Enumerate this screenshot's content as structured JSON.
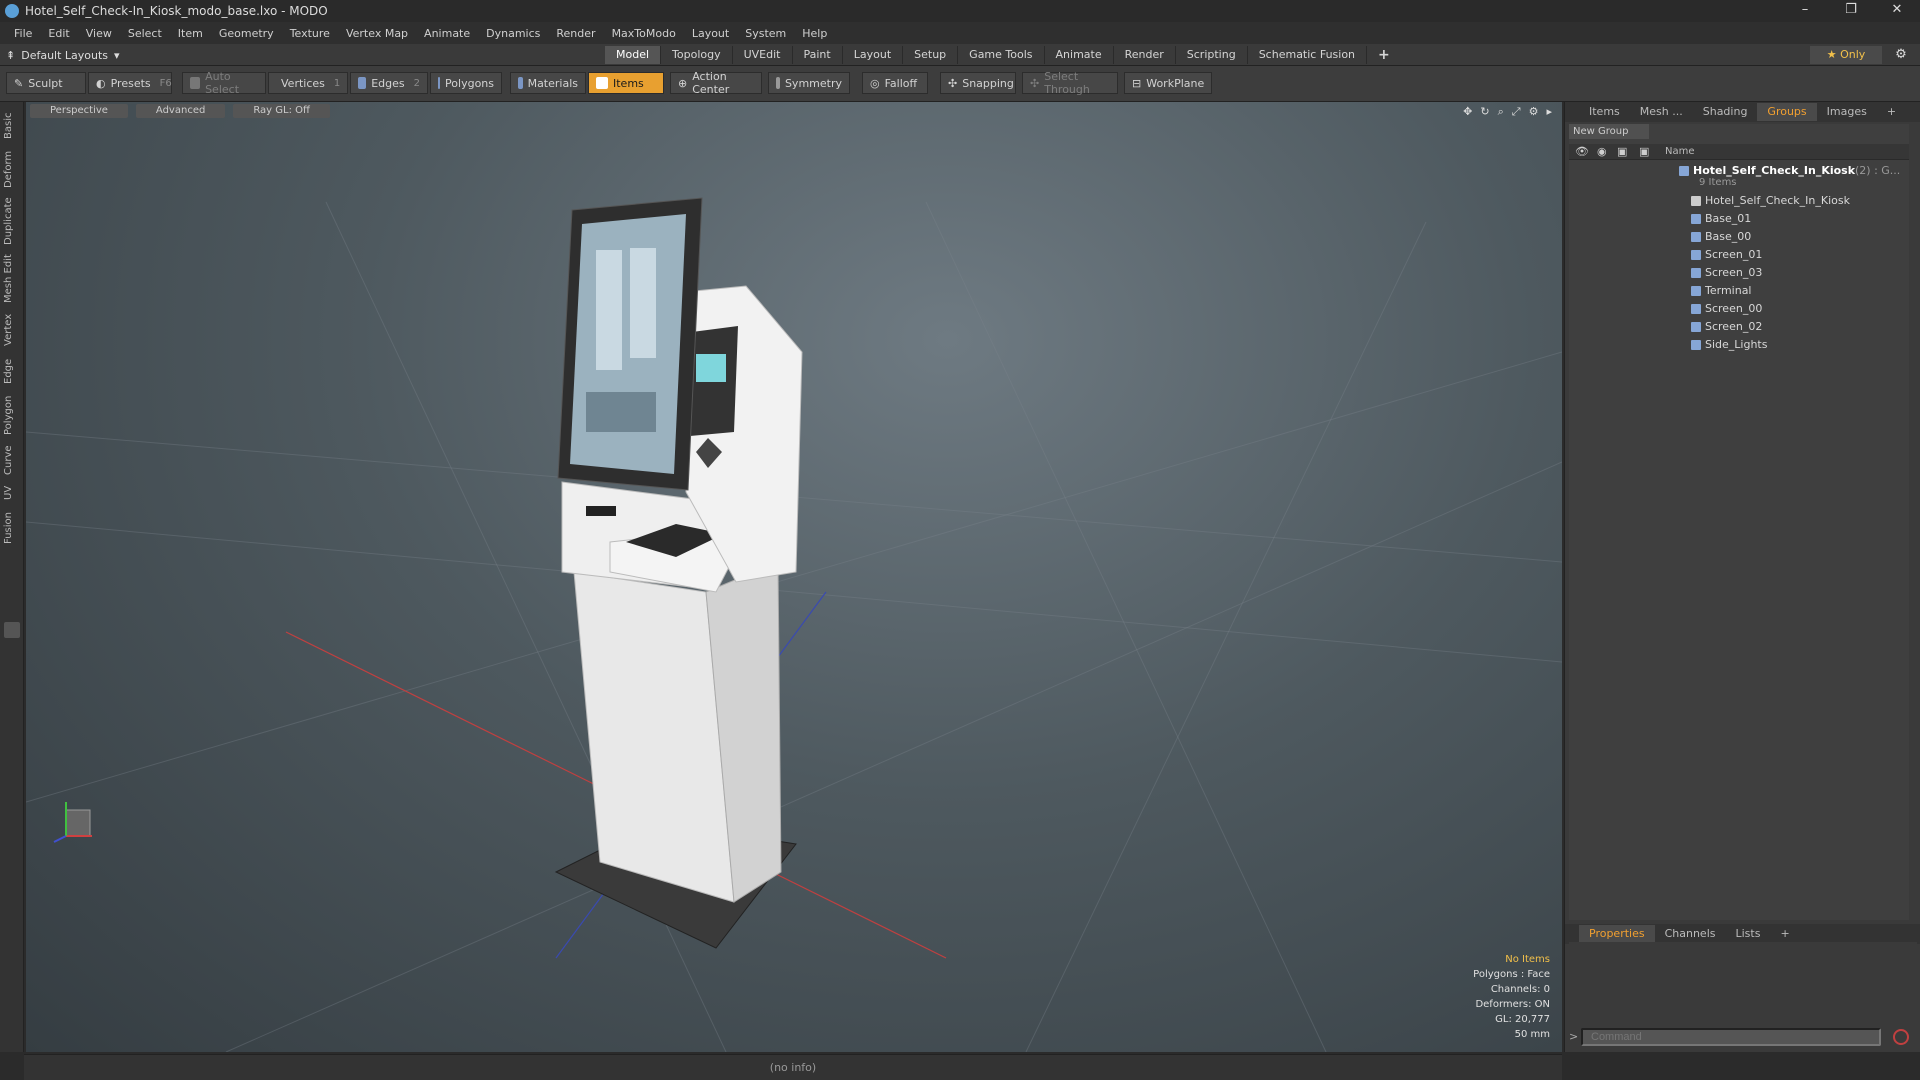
{
  "window": {
    "title": "Hotel_Self_Check-In_Kiosk_modo_base.lxo - MODO",
    "minimize": "–",
    "maximize": "❐",
    "close": "✕"
  },
  "menu": [
    "File",
    "Edit",
    "View",
    "Select",
    "Item",
    "Geometry",
    "Texture",
    "Vertex Map",
    "Animate",
    "Dynamics",
    "Render",
    "MaxToModo",
    "Layout",
    "System",
    "Help"
  ],
  "layout": {
    "selector": "Default Layouts",
    "tabs": [
      "Model",
      "Topology",
      "UVEdit",
      "Paint",
      "Layout",
      "Setup",
      "Game Tools",
      "Animate",
      "Render",
      "Scripting",
      "Schematic Fusion"
    ],
    "active_tab": "Model",
    "add_tab": "+",
    "only_label": "Only"
  },
  "toolbar": {
    "sculpt": "Sculpt",
    "presets": "Presets",
    "presets_key": "F6",
    "auto_select": "Auto Select",
    "vertices": "Vertices",
    "vertices_key": "1",
    "edges": "Edges",
    "edges_key": "2",
    "polygons": "Polygons",
    "materials": "Materials",
    "items": "Items",
    "action_center": "Action Center",
    "symmetry": "Symmetry",
    "falloff": "Falloff",
    "snapping": "Snapping",
    "select_through": "Select Through",
    "workplane": "WorkPlane"
  },
  "left_tabs": [
    "Basic",
    "Deform",
    "Duplicate",
    "Mesh Edit",
    "Vertex",
    "Edge",
    "Polygon",
    "Curve",
    "UV",
    "Fusion"
  ],
  "viewport": {
    "view_mode": "Perspective",
    "shading": "Advanced",
    "raygl": "Ray GL: Off",
    "stats": {
      "selection": "No Items",
      "polygons": "Polygons : Face",
      "channels": "Channels: 0",
      "deformers": "Deformers: ON",
      "gl": "GL: 20,777",
      "focal": "50 mm"
    }
  },
  "right_panel": {
    "top_tabs": [
      "Items",
      "Mesh ...",
      "Shading",
      "Groups",
      "Images"
    ],
    "active_top_tab": "Groups",
    "new_group": "New Group",
    "name_col": "Name",
    "root": {
      "label": "Hotel_Self_Check_In_Kiosk",
      "suffix": "(2) : G...",
      "count": "9 Items"
    },
    "children": [
      "Hotel_Self_Check_In_Kiosk",
      "Base_01",
      "Base_00",
      "Screen_01",
      "Screen_03",
      "Terminal",
      "Screen_00",
      "Screen_02",
      "Side_Lights"
    ],
    "bottom_tabs": [
      "Properties",
      "Channels",
      "Lists"
    ],
    "active_bottom_tab": "Properties",
    "command_placeholder": "Command"
  },
  "status": {
    "info": "(no info)"
  }
}
